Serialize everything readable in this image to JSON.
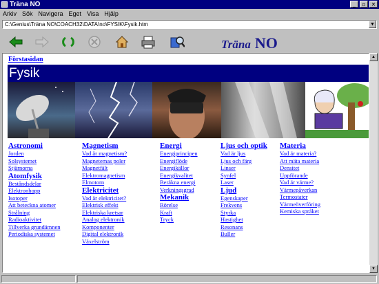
{
  "window": {
    "title": "Träna NO",
    "controls": [
      "_",
      "▫",
      "✕"
    ]
  },
  "menu": [
    "Arkiv",
    "Sök",
    "Navigera",
    "Eget",
    "Visa",
    "Hjälp"
  ],
  "address": "C:\\Genius\\Träna NO\\COACH32\\DATA\\no\\FYSIK\\Fysik.htm",
  "toolbar": {
    "brand_italic": "Träna",
    "brand_bold": "NO"
  },
  "page": {
    "breadcrumb": "Förstasidan",
    "title": "Fysik"
  },
  "columns": [
    {
      "groups": [
        {
          "heading": "Astronomi",
          "links": [
            "Jorden",
            "Solsystemet",
            "Stjärnorna"
          ]
        },
        {
          "heading": "Atomfysik",
          "links": [
            "Beståndsdelar",
            "Elektronhopp",
            "Isotoper",
            "Att beteckna atomer",
            "Strålning",
            "Radioaktivitet",
            "Tillverka grundämnen",
            "Periodiska systemet"
          ]
        }
      ]
    },
    {
      "groups": [
        {
          "heading": "Magnetism",
          "links": [
            "Vad är magnetism?",
            "Magnetemas poler",
            "Magnetfält",
            "Elektromagnetism",
            "Elmotorn"
          ]
        },
        {
          "heading": "Elektricitet",
          "links": [
            "Vad är elektricitet?",
            "Elektrisk effekt",
            "Elektriska kretsar",
            "Analog elektronik",
            "Komponenter",
            "Digital elektronik",
            "Växelström"
          ]
        }
      ]
    },
    {
      "groups": [
        {
          "heading": "Energi",
          "links": [
            "Energiprincipen",
            "Energiflöde",
            "Energikällor",
            "Energikvalitet",
            "Beräkna energi",
            "Verkningsgrad"
          ]
        },
        {
          "heading": "Mekanik",
          "links": [
            "Rörelse",
            "Kraft",
            "Tryck"
          ]
        }
      ]
    },
    {
      "groups": [
        {
          "heading": "Ljus och optik",
          "links": [
            "Vad är ljus",
            "Ljus och färg",
            "Linser",
            "Synfel",
            "Laser"
          ]
        },
        {
          "heading": "Ljud",
          "links": [
            "Egenskaper",
            "Frekvens",
            "Styrka",
            "Hastighet",
            "Resonans",
            "Buller"
          ]
        }
      ]
    },
    {
      "groups": [
        {
          "heading": "Materia",
          "links": [
            "Vad är materia?",
            "Att mäta materia",
            "Densitet",
            "Uppförande",
            "Vad är värme?",
            "Värmepåverkan",
            "Termostater",
            "Värmeöverföring",
            "Kemiska språket"
          ]
        }
      ]
    }
  ],
  "colors": {
    "banner": "#000080",
    "link": "#0000ff",
    "brand": "#1a1a8c"
  }
}
